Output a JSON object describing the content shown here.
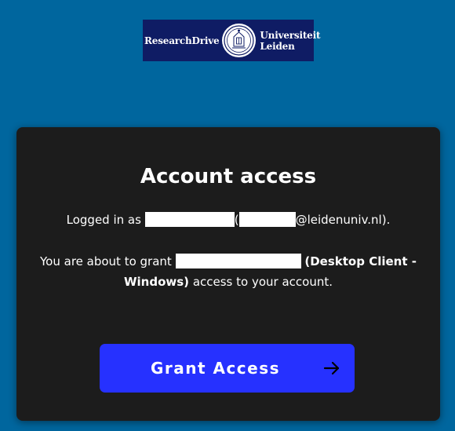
{
  "logo": {
    "left_text": "ResearchDrive",
    "right_line1": "Universiteit",
    "right_line2": "Leiden"
  },
  "card": {
    "title": "Account access",
    "logged_prefix": "Logged in as",
    "logged_paren_open": "(",
    "logged_domain": "@leidenuniv.nl).",
    "grant_prefix": "You are about to grant",
    "client_name": "(Desktop Client - Windows)",
    "grant_suffix": "access to your account."
  },
  "button": {
    "label": "Grant Access",
    "icon": "arrow-right-icon"
  },
  "colors": {
    "page_background": "#00669e",
    "card_background": "#1c1c1c",
    "button_background": "#2631ff",
    "logo_background": "#0f1c64"
  }
}
